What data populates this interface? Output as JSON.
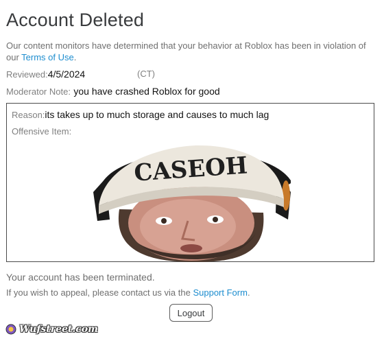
{
  "title": "Account Deleted",
  "intro": {
    "text": "Our content monitors have determined that your behavior at Roblox has been in violation of our ",
    "link": "Terms of Use",
    "end": "."
  },
  "reviewed": {
    "label": "Reviewed:",
    "value": "4/5/2024",
    "timezone": "(CT)"
  },
  "moderator_note": {
    "label": "Moderator Note:",
    "value": "you have crashed Roblox for good"
  },
  "reason": {
    "label": "Reason:",
    "value": "its takes up to much storage and causes to much lag"
  },
  "offensive_item": {
    "label": "Offensive Item:",
    "image_text": "CASEOH"
  },
  "terminated": "Your account has been terminated.",
  "appeal": {
    "text": "If you wish to appeal, please contact us via the ",
    "link": "Support Form",
    "end": "."
  },
  "logout_label": "Logout",
  "watermark": "Wufstreet.com",
  "colors": {
    "link": "#1d8dcf",
    "text": "#393b3d",
    "muted": "#6f6f6f"
  }
}
